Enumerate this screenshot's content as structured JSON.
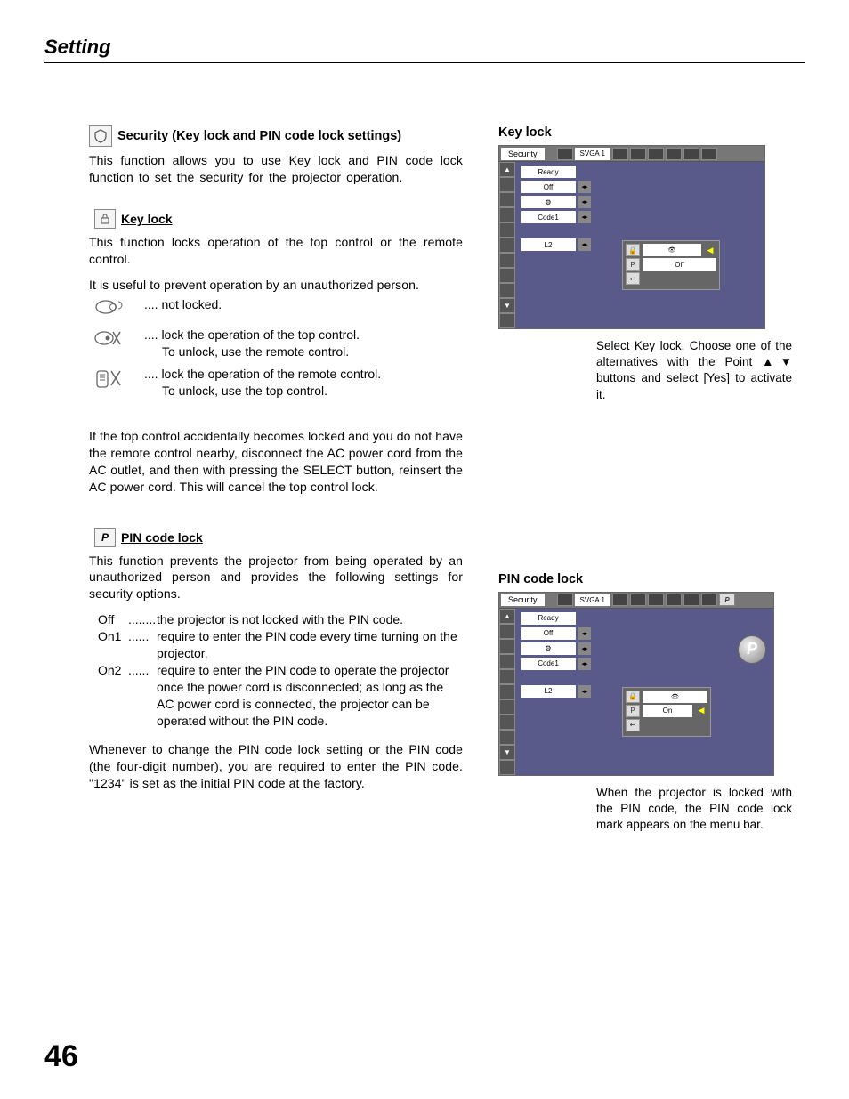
{
  "page": {
    "title": "Setting",
    "number": "46"
  },
  "left": {
    "security": {
      "heading": "Security (Key lock and PIN code lock settings)",
      "intro": "This function allows you to use Key lock and PIN code lock function to set the security for the projector operation."
    },
    "keylock": {
      "heading": "Key lock",
      "p1": "This function locks operation of the top control or the remote control.",
      "p2": "It is useful to prevent operation by an unauthorized person.",
      "opt1": ".... not locked.",
      "opt2a": ".... lock the operation of the top control.",
      "opt2b": "To unlock, use the remote control.",
      "opt3a": ".... lock the operation of the remote control.",
      "opt3b": "To unlock, use the top control.",
      "note": "If the top control accidentally becomes locked and you do not have the remote control nearby, disconnect the AC power cord from the AC outlet, and then with pressing the SELECT button, reinsert the AC power cord.  This will cancel the top control lock."
    },
    "pinlock": {
      "heading": "PIN code lock",
      "intro": "This function prevents the projector from being operated by an unauthorized person and provides the following settings for security options.",
      "off_lbl": "Off",
      "off_txt": "the projector is not locked with the PIN code.",
      "on1_lbl": "On1",
      "on1_txt": "require to enter the PIN code every time turning on the projector.",
      "on2_lbl": "On2",
      "on2_txt": "require to enter the PIN code to operate the projector once the power cord is disconnected; as long as the AC power cord is connected, the projector can be operated without the PIN code.",
      "dots8": "........",
      "dots6": "......",
      "note": "Whenever to change the PIN code lock setting or the PIN code (the four-digit number), you are required to enter the PIN code.  \"1234\" is set as the initial PIN code at the factory."
    }
  },
  "right": {
    "keylock_heading": "Key lock",
    "pinlock_heading": "PIN code lock",
    "osd": {
      "title": "Security",
      "mode": "SVGA 1",
      "rows": {
        "r1": "Ready",
        "r2": "Off",
        "r3": "⚙",
        "r4": "Code1",
        "r5": "L2"
      },
      "popup_keylock_val": "Off",
      "popup_pinlock_val": "On"
    },
    "caption_keylock": "Select Key lock.  Choose one of the alternatives with the Point ▲▼ buttons and select [Yes] to activate it.",
    "caption_pinlock": "When the projector is locked with the PIN code, the PIN code lock mark appears on the menu bar.",
    "badge": "P"
  }
}
